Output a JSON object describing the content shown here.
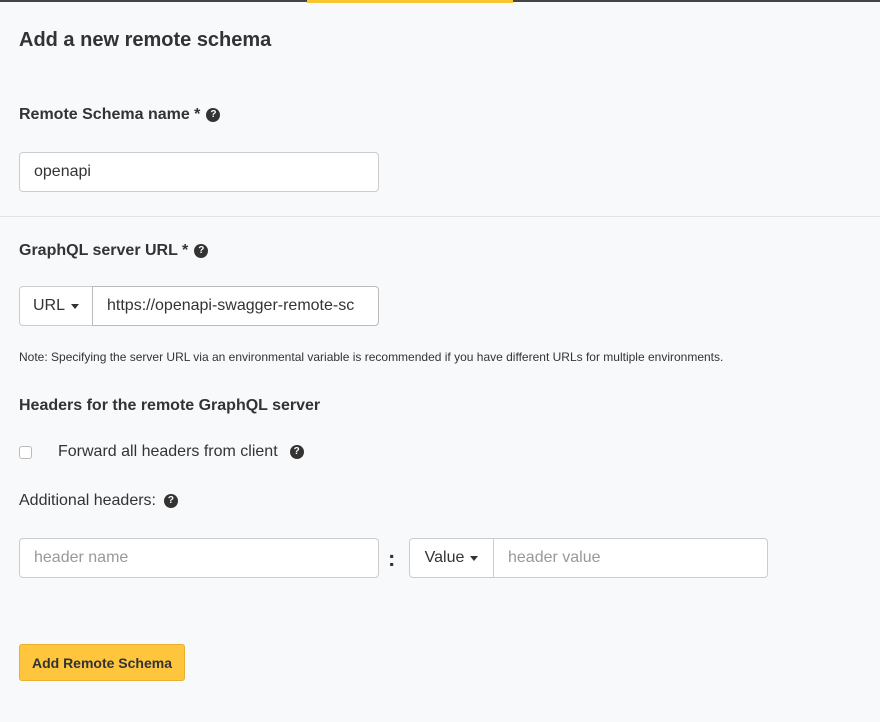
{
  "page": {
    "title": "Add a new remote schema"
  },
  "colors": {
    "accent": "#f8c630",
    "primary_button": "#fec53d",
    "background": "#f8f9fa"
  },
  "schema_name": {
    "label": "Remote Schema name *",
    "help_icon": "question-circle-icon",
    "value": "openapi"
  },
  "server_url": {
    "label": "GraphQL server URL *",
    "help_icon": "question-circle-icon",
    "type_selector": "URL",
    "value": "https://openapi-swagger-remote-sc",
    "note": "Note: Specifying the server URL via an environmental variable is recommended if you have different URLs for multiple environments."
  },
  "headers": {
    "section_title": "Headers for the remote GraphQL server",
    "forward_label": "Forward all headers from client",
    "forward_checked": false,
    "additional_label": "Additional headers:",
    "name_placeholder": "header name",
    "separator": ":",
    "value_type": "Value",
    "value_placeholder": "header value"
  },
  "actions": {
    "submit_label": "Add Remote Schema"
  }
}
